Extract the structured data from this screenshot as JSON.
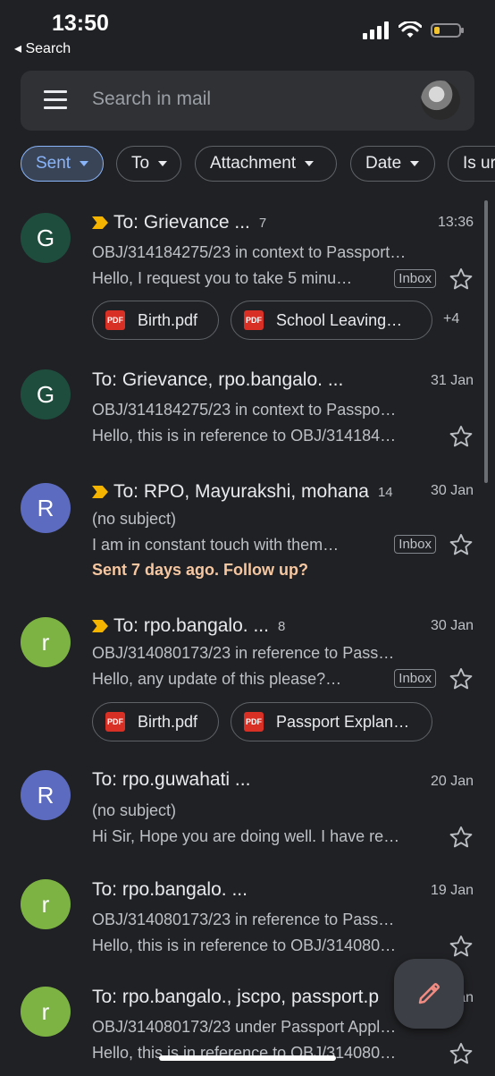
{
  "status": {
    "time": "13:50",
    "back_label": "◂ Search"
  },
  "search": {
    "placeholder": "Search in mail"
  },
  "chips": [
    {
      "label": "Sent",
      "active": true
    },
    {
      "label": "To"
    },
    {
      "label": "Attachment"
    },
    {
      "label": "Date"
    },
    {
      "label": "Is ur"
    }
  ],
  "emails": [
    {
      "avatar_letter": "G",
      "avatar_color": "#1e4d3e",
      "important": true,
      "recipients": "To: Grievance ...",
      "count": "7",
      "date": "13:36",
      "subject": "OBJ/314184275/23 in context to Passport…",
      "snippet": "Hello, I request you to take 5 minu…",
      "label": "Inbox",
      "attachments": [
        "Birth.pdf",
        "School Leaving…"
      ],
      "more": "+4"
    },
    {
      "avatar_letter": "G",
      "avatar_color": "#1e4d3e",
      "important": false,
      "recipients": "To: Grievance, rpo.bangalo. ...",
      "count": "",
      "date": "31 Jan",
      "subject": "OBJ/314184275/23 in context to Passpo…",
      "snippet": "Hello, this is in reference to OBJ/314184…",
      "label": ""
    },
    {
      "avatar_letter": "R",
      "avatar_color": "#5c6bc0",
      "important": true,
      "recipients": "To: RPO, Mayurakshi, mohana",
      "count": "14",
      "date": "30 Jan",
      "subject": "(no subject)",
      "snippet": "I am in constant touch with them…",
      "label": "Inbox",
      "followup": "Sent 7 days ago. Follow up?"
    },
    {
      "avatar_letter": "r",
      "avatar_color": "#7cb342",
      "important": true,
      "recipients": "To: rpo.bangalo. ...",
      "count": "8",
      "date": "30 Jan",
      "subject": "OBJ/314080173/23 in reference to Pass…",
      "snippet": "Hello, any update of this please?…",
      "label": "Inbox",
      "attachments": [
        "Birth.pdf",
        "Passport Explan…"
      ]
    },
    {
      "avatar_letter": "R",
      "avatar_color": "#5c6bc0",
      "important": false,
      "recipients": "To: rpo.guwahati ...",
      "count": "",
      "date": "20 Jan",
      "subject": "(no subject)",
      "snippet": "Hi Sir, Hope you are doing well. I have re…",
      "label": ""
    },
    {
      "avatar_letter": "r",
      "avatar_color": "#7cb342",
      "important": false,
      "recipients": "To: rpo.bangalo. ...",
      "count": "",
      "date": "19 Jan",
      "subject": "OBJ/314080173/23 in reference to Pass…",
      "snippet": "Hello, this is in reference to OBJ/314080…",
      "label": ""
    },
    {
      "avatar_letter": "r",
      "avatar_color": "#7cb342",
      "important": false,
      "recipients": "To: rpo.bangalo., jscpo, passport.p",
      "count": "",
      "date": "18 Jan",
      "subject": "OBJ/314080173/23 under Passport Appl…",
      "snippet": "Hello, this is in reference to OBJ/314080…",
      "label": ""
    }
  ],
  "compose": {
    "icon": "pencil-icon",
    "color": "#f28b82"
  }
}
